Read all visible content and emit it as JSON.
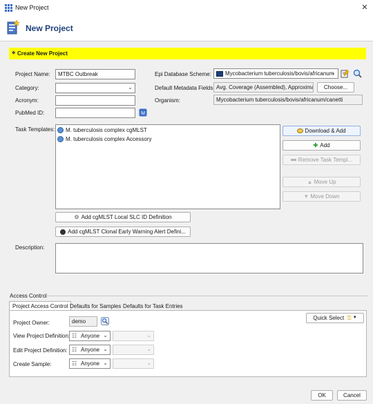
{
  "window": {
    "title": "New Project",
    "close_glyph": "✕"
  },
  "header": {
    "title": "New Project",
    "icon": "project-wizard-icon"
  },
  "banner": {
    "text": "Create New Project",
    "bullet": "◆"
  },
  "form": {
    "project_name": {
      "label": "Project Name:",
      "value": "MTBC Outbreak"
    },
    "category": {
      "label": "Category:",
      "value": ""
    },
    "acronym": {
      "label": "Acronym:",
      "value": ""
    },
    "pubmed": {
      "label": "PubMed ID:",
      "value": ""
    },
    "epi_scheme": {
      "label": "Epi Database Scheme:",
      "value": "Mycobacterium tuberculosis/bovis/africanum"
    },
    "metadata_fields": {
      "label": "Default Metadata Fields:",
      "value": "Avg. Coverage (Assembled), Approximat",
      "button": "Choose..."
    },
    "organism": {
      "label": "Organism:",
      "value": "Mycobacterium tuberculosis/bovis/africanum/canetti"
    }
  },
  "task_templates": {
    "label": "Task Templates:",
    "items": [
      "M. tuberculosis complex cgMLST",
      "M. tuberculosis complex Accessory"
    ],
    "buttons": {
      "download_add": "Download & Add",
      "add": "Add",
      "remove": "Remove Task Templ...",
      "move_up": "Move Up",
      "move_down": "Move Down"
    }
  },
  "actions": {
    "slc": "Add cgMLST Local SLC ID Definition",
    "early_warning": "Add cgMLST Clonal Early Warning Alert Defini..."
  },
  "description": {
    "label": "Description:",
    "value": ""
  },
  "access_control": {
    "title": "Access Control",
    "tabs": [
      "Project Access Control",
      "Defaults for Samples",
      "Defaults for Task Entries"
    ],
    "owner": {
      "label": "Project Owner:",
      "value": "demo"
    },
    "quick_select": "Quick Select",
    "rows": [
      {
        "label": "View Project Definition:",
        "value": "Anyone"
      },
      {
        "label": "Edit Project Definition:",
        "value": "Anyone"
      },
      {
        "label": "Create Sample:",
        "value": "Anyone"
      }
    ]
  },
  "footer": {
    "ok": "OK",
    "cancel": "Cancel"
  },
  "colors": {
    "banner": "#ffff00",
    "header_title": "#1f3f7a",
    "accent": "#3a6ec8"
  }
}
